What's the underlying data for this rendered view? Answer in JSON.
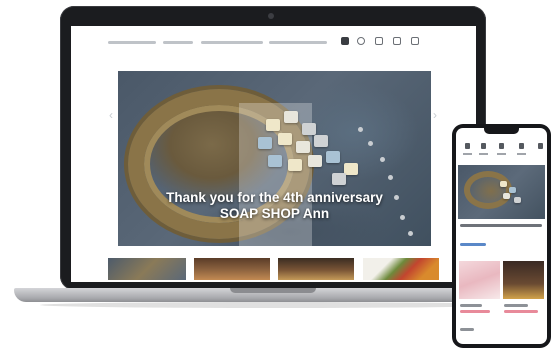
{
  "hero": {
    "caption_line1": "Thank you for the 4th anniversary",
    "caption_line2": "SOAP SHOP Ann",
    "prev_arrow": "‹",
    "next_arrow": "›"
  },
  "colors": {
    "device_frame": "#1b1c1f",
    "phone_frame": "#16171a",
    "accent_pink": "#e88a9a",
    "accent_blue": "#5a88c8"
  }
}
